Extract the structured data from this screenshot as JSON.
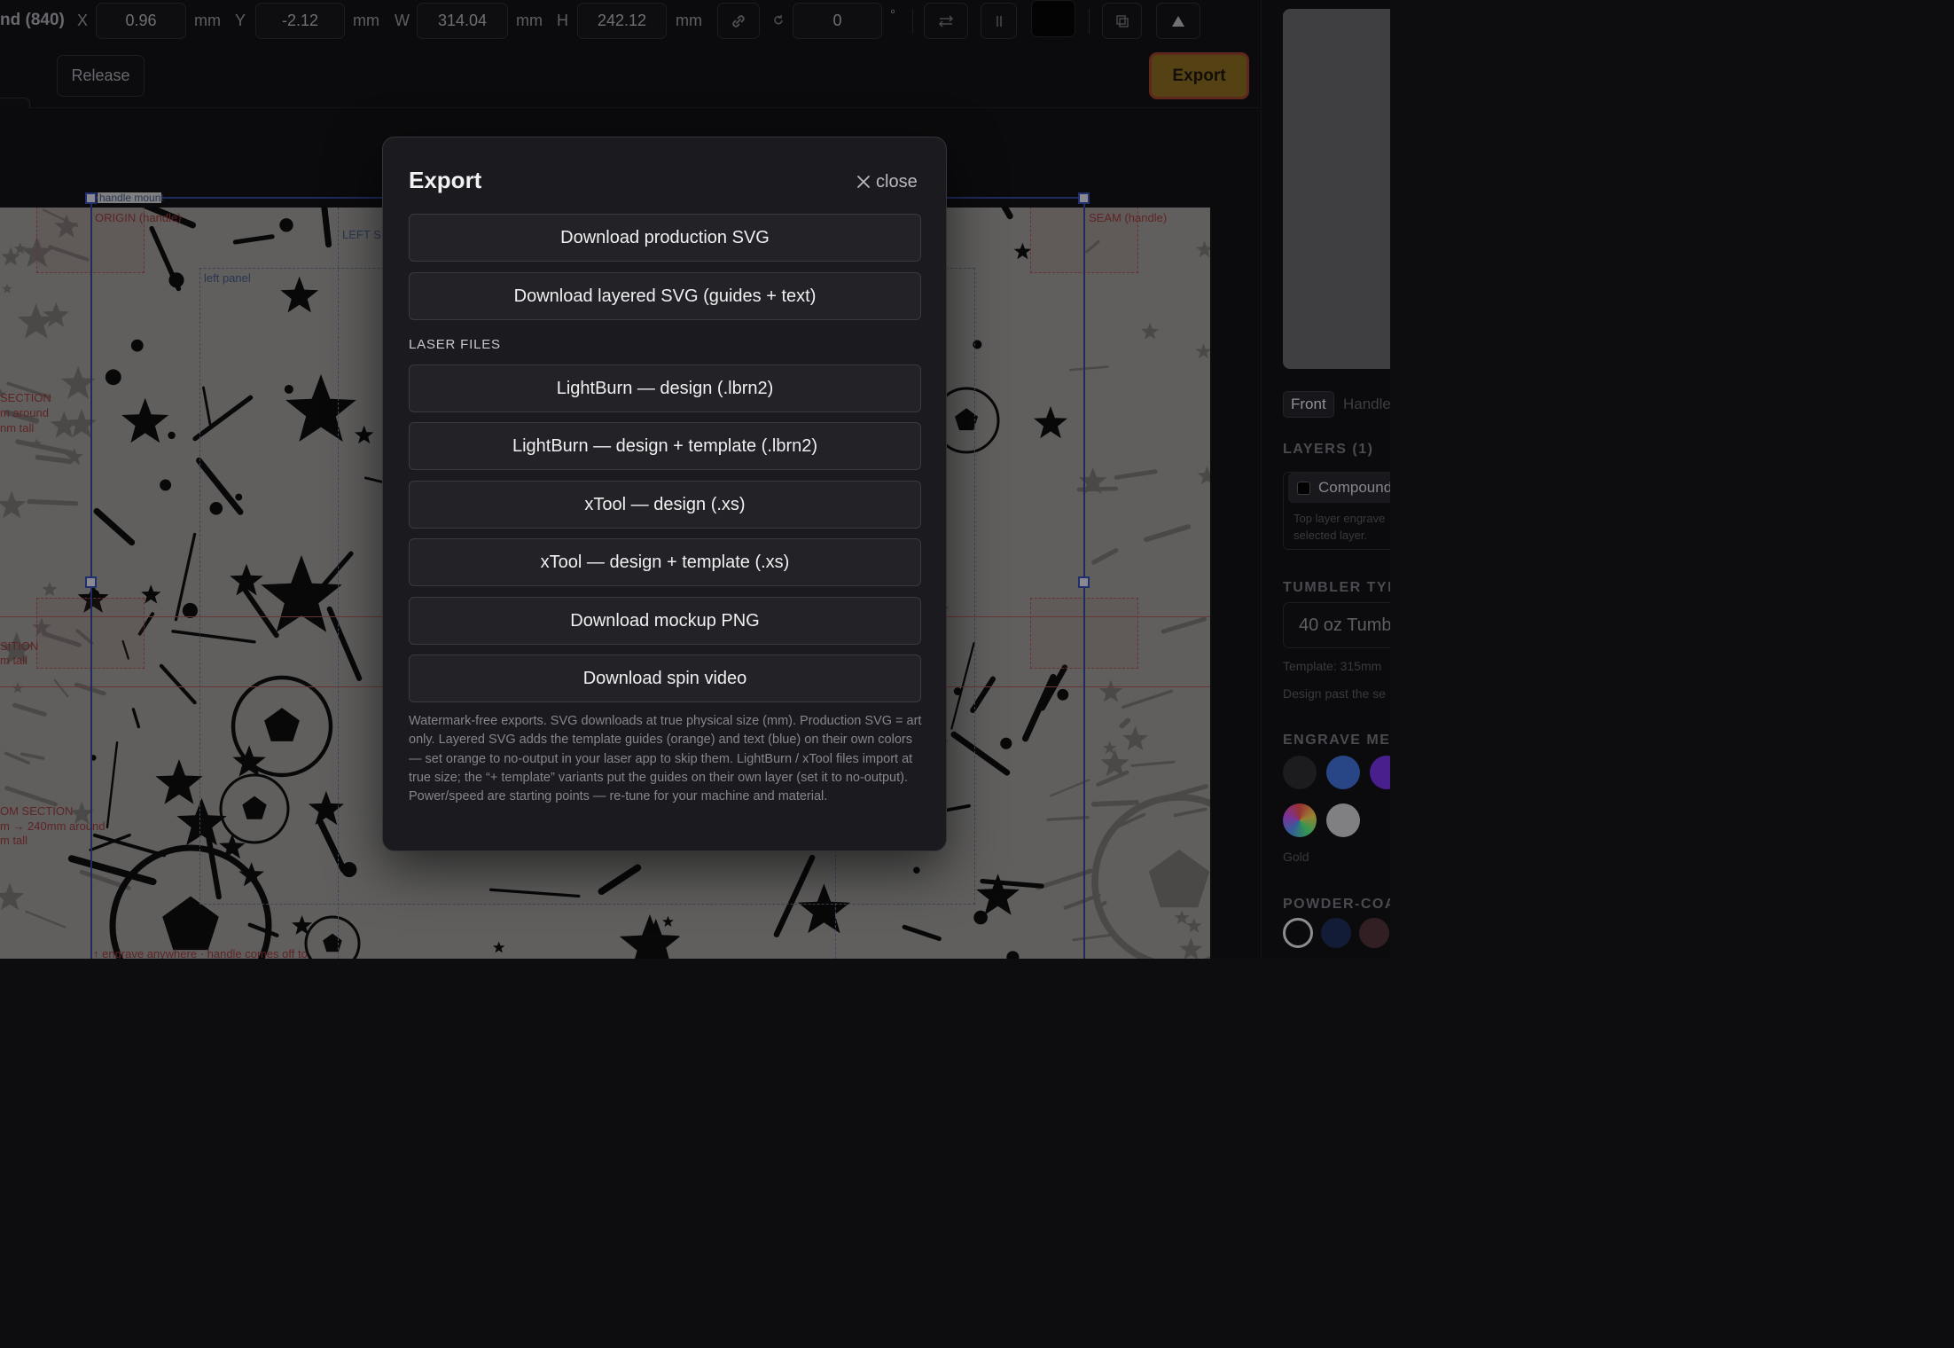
{
  "toolbar": {
    "title": "nd (840)",
    "x_label": "X",
    "x_value": "0.96",
    "y_label": "Y",
    "y_value": "-2.12",
    "w_label": "W",
    "w_value": "314.04",
    "h_label": "H",
    "h_value": "242.12",
    "unit": "mm",
    "rotation_value": "0",
    "degree": "°",
    "release_label": "Release",
    "export_label": "Export"
  },
  "canvas": {
    "labels": {
      "handle_mount": "handle mount",
      "origin": "ORIGIN (handle)",
      "seam": "SEAM (handle)",
      "left_section": "LEFT S",
      "left_panel": "left panel",
      "section_1": "SECTION",
      "section_1b": "m around",
      "section_1c": "nm tall",
      "position": "SITION",
      "position_b": "m tall",
      "bottom_section": "OM SECTION",
      "bottom_section_b": "m → 240mm around",
      "bottom_section_c": "m tall",
      "bottom_note": "↑ engrave anywhere · handle comes off to"
    }
  },
  "sidebar": {
    "tabs": [
      "Front",
      "Handle"
    ],
    "layers_heading": "LAYERS (1)",
    "layer_name": "Compound",
    "layer_hint_1": "Top layer engrave",
    "layer_hint_2": "selected layer.",
    "tumbler_heading": "TUMBLER TYP",
    "tumbler_value": "40 oz Tumb",
    "template_note": "Template: 315mm",
    "design_note": "Design past the se",
    "engrave_heading": "ENGRAVE MET",
    "engrave_selected": "Gold",
    "powder_heading": "POWDER-COA",
    "engrave_colors": [
      "#2a2a2e",
      "#3b67c4",
      "#6a2fd0",
      "#c98a3a",
      "#bdbdc2"
    ],
    "powder_colors": [
      "#0f0f12",
      "#1d2a52",
      "#4a2e35"
    ]
  },
  "modal": {
    "title": "Export",
    "close_label": "close",
    "buttons": [
      "Download production SVG",
      "Download layered SVG (guides + text)",
      "LightBurn — design (.lbrn2)",
      "LightBurn — design + template (.lbrn2)",
      "xTool — design (.xs)",
      "xTool — design + template (.xs)",
      "Download mockup PNG",
      "Download spin video"
    ],
    "section_label": "LASER FILES",
    "footnote": "Watermark-free exports. SVG downloads at true physical size (mm). Production SVG = art only. Layered SVG adds the template guides (orange) and text (blue) on their own colors — set orange to no-output in your laser app to skip them. LightBurn / xTool files import at true size; the “+ template” variants put the guides on their own layer (set it to no-output). Power/speed are starting points — re-tune for your machine and material."
  }
}
